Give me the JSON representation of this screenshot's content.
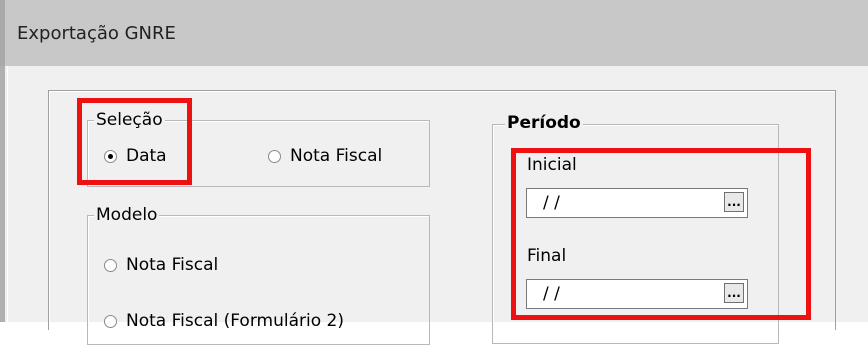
{
  "window": {
    "title": "Exportação GNRE"
  },
  "selecao": {
    "label": "Seleção",
    "options": [
      {
        "label": "Data",
        "selected": true
      },
      {
        "label": "Nota Fiscal",
        "selected": false
      }
    ]
  },
  "modelo": {
    "label": "Modelo",
    "options": [
      {
        "label": "Nota Fiscal",
        "selected": false
      },
      {
        "label": "Nota Fiscal (Formulário 2)",
        "selected": false
      }
    ]
  },
  "periodo": {
    "label": "Período",
    "inicial": {
      "label": "Inicial",
      "value": " / /",
      "button": "..."
    },
    "final": {
      "label": "Final",
      "value": " / /",
      "button": "..."
    }
  },
  "colors": {
    "highlight": "#ee1111",
    "dialog_bg": "#f0f0f0",
    "titlebar_bg": "#c8c8c8"
  }
}
